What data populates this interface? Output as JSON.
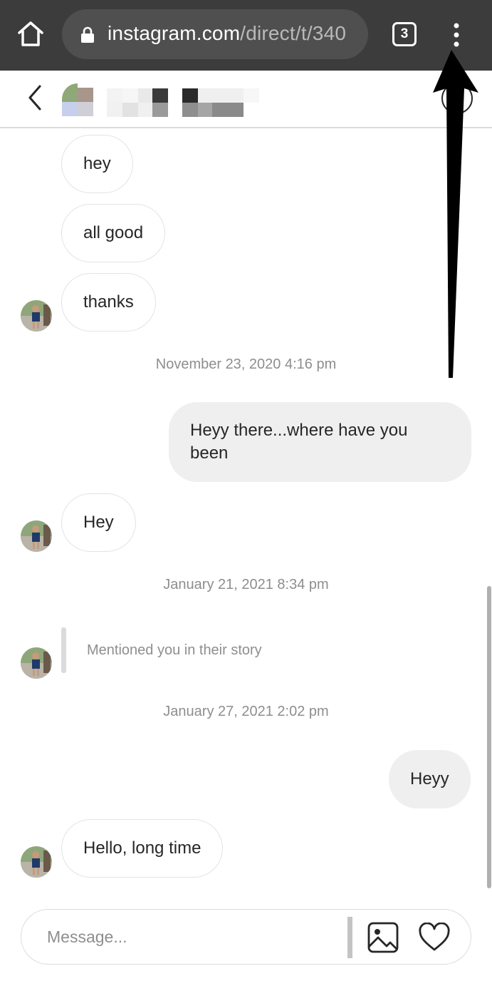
{
  "browser": {
    "url_domain": "instagram.com",
    "url_path": "/direct/t/340",
    "tab_count": "3",
    "icons": [
      "home-icon",
      "lock-icon",
      "tabs-icon",
      "more-vert-icon"
    ]
  },
  "header": {
    "icons": [
      "back-arrow-icon",
      "info-icon"
    ]
  },
  "messages": [
    {
      "side": "in",
      "text": "hey"
    },
    {
      "side": "in",
      "text": "all good"
    },
    {
      "side": "in",
      "text": "thanks"
    },
    {
      "type": "timestamp",
      "text": "November 23, 2020 4:16 pm"
    },
    {
      "side": "out",
      "text": "Heyy there...where have you been"
    },
    {
      "side": "in",
      "text": "Hey"
    },
    {
      "type": "timestamp",
      "text": "January 21, 2021 8:34 pm"
    },
    {
      "type": "story_mention",
      "text": "Mentioned you in their story"
    },
    {
      "type": "timestamp",
      "text": "January 27, 2021 2:02 pm"
    },
    {
      "side": "out",
      "text": "Heyy"
    },
    {
      "side": "in",
      "text": "Hello, long time"
    }
  ],
  "composer": {
    "placeholder": "Message...",
    "icons": [
      "gallery-icon",
      "heart-icon"
    ]
  },
  "colors": {
    "browser_bar": "#3c3c3c",
    "outgoing_bubble": "#efefef",
    "muted_text": "#8e8e8e"
  }
}
